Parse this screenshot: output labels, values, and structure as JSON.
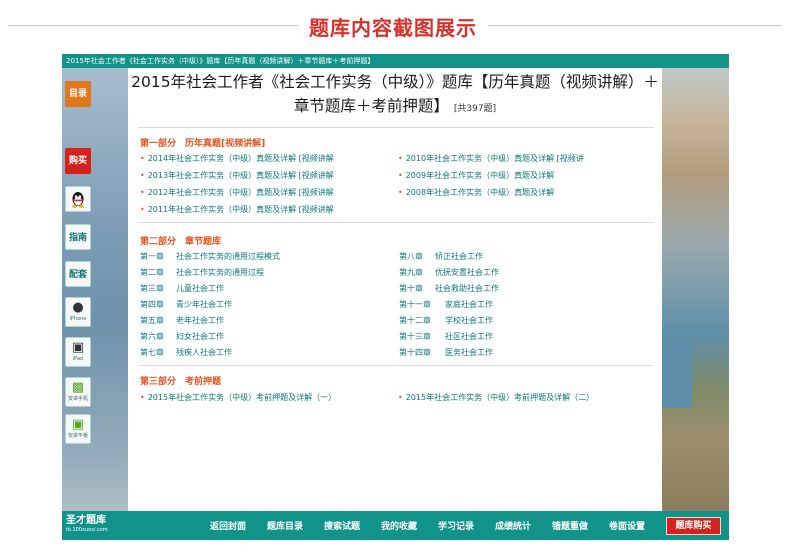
{
  "heading": "题库内容截图展示",
  "window": {
    "topbar_title": "2015年社会工作者《社会工作实务（中级）》题库【历年真题（视频讲解）＋章节题库＋考前押题】"
  },
  "rail": {
    "catalog": "目录",
    "buy": "购买",
    "guide": "指南",
    "bundle": "配套",
    "iphone": "iPhone",
    "ipad": "iPad",
    "android_phone": "安卓手机",
    "android_tablet": "安卓平板"
  },
  "content": {
    "title_line1": "2015年社会工作者《社会工作实务（中级）》题库【历年真题（视频讲解）＋",
    "title_line2": "章节题库＋考前押题】",
    "count": "[共397题]",
    "section1": {
      "heading": "第一部分　历年真题[视频讲解]",
      "left": [
        "2014年社会工作实务（中级）真题及详解 [视频讲解",
        "2013年社会工作实务（中级）真题及详解 [视频讲解",
        "2012年社会工作实务（中级）真题及详解 [视频讲解",
        "2011年社会工作实务（中级）真题及详解 [视频讲解"
      ],
      "right": [
        "2010年社会工作实务（中级）真题及详解 [视频讲",
        "2009年社会工作实务（中级）真题及详解",
        "2008年社会工作实务（中级）真题及详解"
      ]
    },
    "section2": {
      "heading": "第二部分　章节题库",
      "left": [
        {
          "num": "第一章",
          "name": "社会工作实务的通用过程模式"
        },
        {
          "num": "第二章",
          "name": "社会工作实务的通用过程"
        },
        {
          "num": "第三章",
          "name": "儿童社会工作"
        },
        {
          "num": "第四章",
          "name": "青少年社会工作"
        },
        {
          "num": "第五章",
          "name": "老年社会工作"
        },
        {
          "num": "第六章",
          "name": "妇女社会工作"
        },
        {
          "num": "第七章",
          "name": "残疾人社会工作"
        }
      ],
      "right": [
        {
          "num": "第八章",
          "name": "矫正社会工作"
        },
        {
          "num": "第九章",
          "name": "优抚安置社会工作"
        },
        {
          "num": "第十章",
          "name": "社会救助社会工作"
        },
        {
          "num": "第十一章",
          "name": "家庭社会工作"
        },
        {
          "num": "第十二章",
          "name": "学校社会工作"
        },
        {
          "num": "第十三章",
          "name": "社区社会工作"
        },
        {
          "num": "第十四章",
          "name": "医务社会工作"
        }
      ]
    },
    "section3": {
      "heading": "第三部分　考前押题",
      "left": [
        "2015年社会工作实务（中级）考前押题及详解（一）"
      ],
      "right": [
        "2015年社会工作实务（中级）考前押题及详解（二）"
      ]
    }
  },
  "bottombar": {
    "logo": "圣才题库",
    "logo_sub": "tk.100xuexi.com",
    "nav": [
      "返回封面",
      "题库目录",
      "搜索试题",
      "我的收藏",
      "学习记录",
      "成绩统计",
      "错题重做",
      "卷面设置"
    ],
    "buy": "题库购买"
  },
  "colors": {
    "accent": "#129389",
    "heading_red": "#d8312b",
    "section_orange": "#e0561e",
    "link_teal": "#0d7a73"
  }
}
